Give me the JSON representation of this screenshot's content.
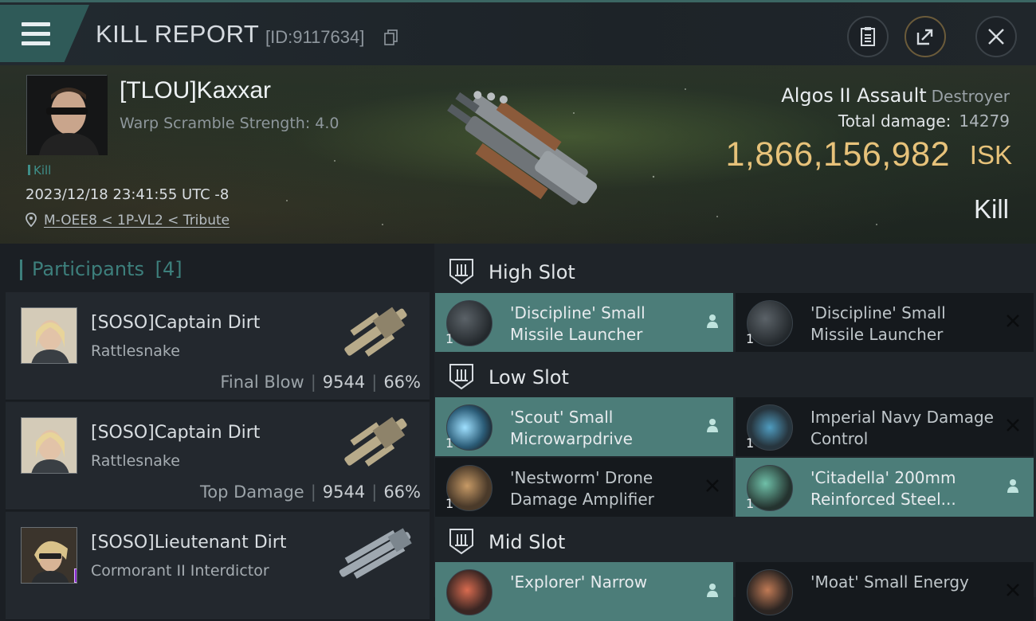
{
  "header": {
    "title": "KILL REPORT",
    "report_id": "[ID:9117634]"
  },
  "victim": {
    "name": "[TLOU]Kaxxar",
    "warp_scramble": "Warp Scramble Strength: 4.0",
    "tag": "Kill",
    "timestamp": "2023/12/18 23:41:55 UTC -8",
    "location": "M-OEE8 < 1P-VL2 < Tribute"
  },
  "ship": {
    "name": "Algos II Assault",
    "class": "Destroyer",
    "total_damage_label": "Total damage:",
    "total_damage": "14279",
    "isk_value": "1,866,156,982",
    "isk_label": "ISK",
    "result": "Kill"
  },
  "participants": {
    "label": "Participants",
    "count": "[4]",
    "items": [
      {
        "name": "[SOSO]Captain Dirt",
        "ship": "Rattlesnake",
        "role": "Final Blow",
        "damage": "9544",
        "percent": "66%"
      },
      {
        "name": "[SOSO]Captain Dirt",
        "ship": "Rattlesnake",
        "role": "Top Damage",
        "damage": "9544",
        "percent": "66%"
      },
      {
        "name": "[SOSO]Lieutenant Dirt",
        "ship": "Cormorant II Interdictor",
        "role": "",
        "damage": "",
        "percent": ""
      }
    ]
  },
  "slots": {
    "high": {
      "label": "High Slot",
      "items": [
        {
          "name": "'Discipline' Small Missile Launcher",
          "qty": "1",
          "state": "fitted"
        },
        {
          "name": "'Discipline' Small Missile Launcher",
          "qty": "1",
          "state": "destroyed"
        }
      ]
    },
    "low": {
      "label": "Low Slot",
      "items": [
        {
          "name": "'Scout' Small Microwarpdrive",
          "qty": "1",
          "state": "fitted"
        },
        {
          "name": "Imperial Navy Damage Control",
          "qty": "1",
          "state": "destroyed"
        },
        {
          "name": "'Nestworm' Drone Damage Amplifier",
          "qty": "1",
          "state": "destroyed"
        },
        {
          "name": "'Citadella' 200mm Reinforced Steel...",
          "qty": "1",
          "state": "fitted"
        }
      ]
    },
    "mid": {
      "label": "Mid Slot",
      "items": [
        {
          "name": "'Explorer' Narrow",
          "qty": "",
          "state": "fitted"
        },
        {
          "name": "'Moat' Small Energy",
          "qty": "",
          "state": "destroyed"
        }
      ]
    }
  },
  "colors": {
    "accent_teal": "#4c7d79",
    "isk_gold": "#e7c27a"
  }
}
